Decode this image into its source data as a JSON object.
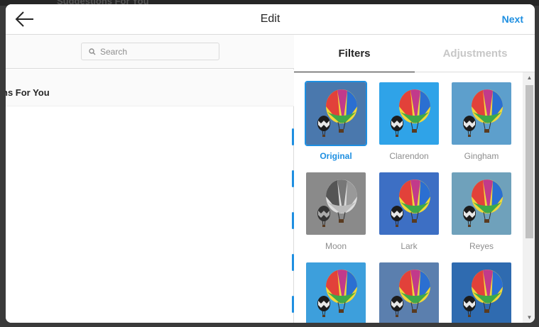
{
  "background": {
    "text": "Suggestions For You"
  },
  "header": {
    "title": "Edit",
    "next_label": "Next"
  },
  "left": {
    "search_placeholder": "Search",
    "suggestions_label": "ns For You"
  },
  "tabs": [
    {
      "label": "Filters",
      "active": true
    },
    {
      "label": "Adjustments",
      "active": false
    }
  ],
  "filters": [
    {
      "label": "Original",
      "selected": true,
      "sky": "#4a78ad"
    },
    {
      "label": "Clarendon",
      "selected": false,
      "sky": "#2fa3e8"
    },
    {
      "label": "Gingham",
      "selected": false,
      "sky": "#5d9fcc"
    },
    {
      "label": "Moon",
      "selected": false,
      "sky": "#8a8a8a"
    },
    {
      "label": "Lark",
      "selected": false,
      "sky": "#3d6fc4"
    },
    {
      "label": "Reyes",
      "selected": false,
      "sky": "#6fa1bb"
    },
    {
      "label": "",
      "selected": false,
      "sky": "#3d9fdc"
    },
    {
      "label": "",
      "selected": false,
      "sky": "#5b7fae"
    },
    {
      "label": "",
      "selected": false,
      "sky": "#2f6bb0"
    }
  ],
  "colors": {
    "accent": "#1e8fe1",
    "text": "#262626",
    "muted": "#8e8e8e"
  }
}
